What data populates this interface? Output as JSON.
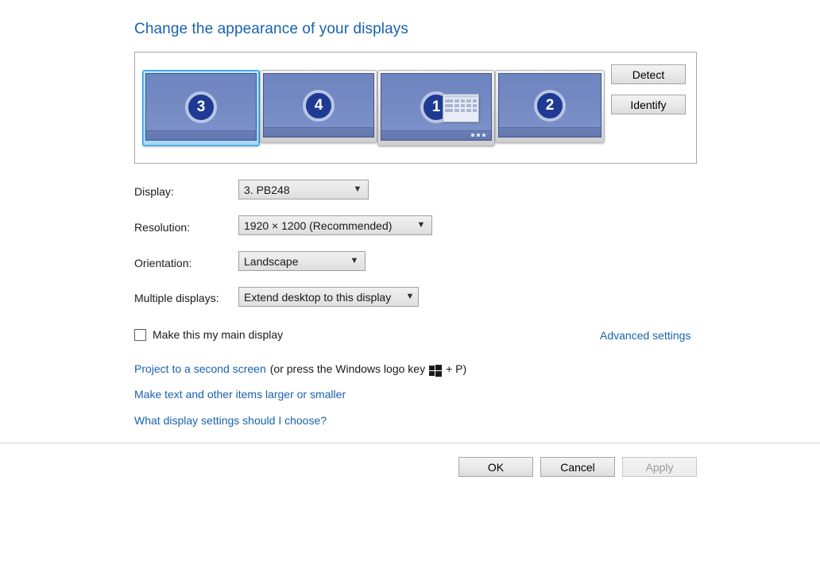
{
  "page": {
    "title": "Change the appearance of your displays"
  },
  "preview": {
    "buttons": {
      "detect": "Detect",
      "identify": "Identify"
    },
    "monitors": [
      {
        "number": "3",
        "selected": true,
        "has_taskbar": false,
        "has_start_glyph": false
      },
      {
        "number": "4",
        "selected": false,
        "has_taskbar": false,
        "has_start_glyph": false
      },
      {
        "number": "1",
        "selected": false,
        "has_taskbar": true,
        "has_start_glyph": true
      },
      {
        "number": "2",
        "selected": false,
        "has_taskbar": false,
        "has_start_glyph": false
      }
    ]
  },
  "form": {
    "display": {
      "label": "Display:",
      "value": "3. PB248"
    },
    "resolution": {
      "label": "Resolution:",
      "value": "1920 × 1200 (Recommended)"
    },
    "orientation": {
      "label": "Orientation:",
      "value": "Landscape"
    },
    "multiple_displays": {
      "label": "Multiple displays:",
      "value": "Extend desktop to this display"
    },
    "main_display_checkbox": {
      "label": "Make this my main display",
      "checked": false
    },
    "advanced_settings_link": "Advanced settings"
  },
  "links": {
    "project_link": "Project to a second screen",
    "project_suffix_before": "(or press the Windows logo key",
    "project_suffix_after": "+ P)",
    "text_size_link": "Make text and other items larger or smaller",
    "help_link": "What display settings should I choose?"
  },
  "footer": {
    "ok": "OK",
    "cancel": "Cancel",
    "apply": "Apply",
    "apply_disabled": true
  },
  "colors": {
    "link_blue": "#1961b0",
    "title_blue": "#1961b0",
    "monitor_screen": "#7489c2",
    "monitor_badge": "#1f3a93",
    "selection_border": "#2f9fe0"
  }
}
